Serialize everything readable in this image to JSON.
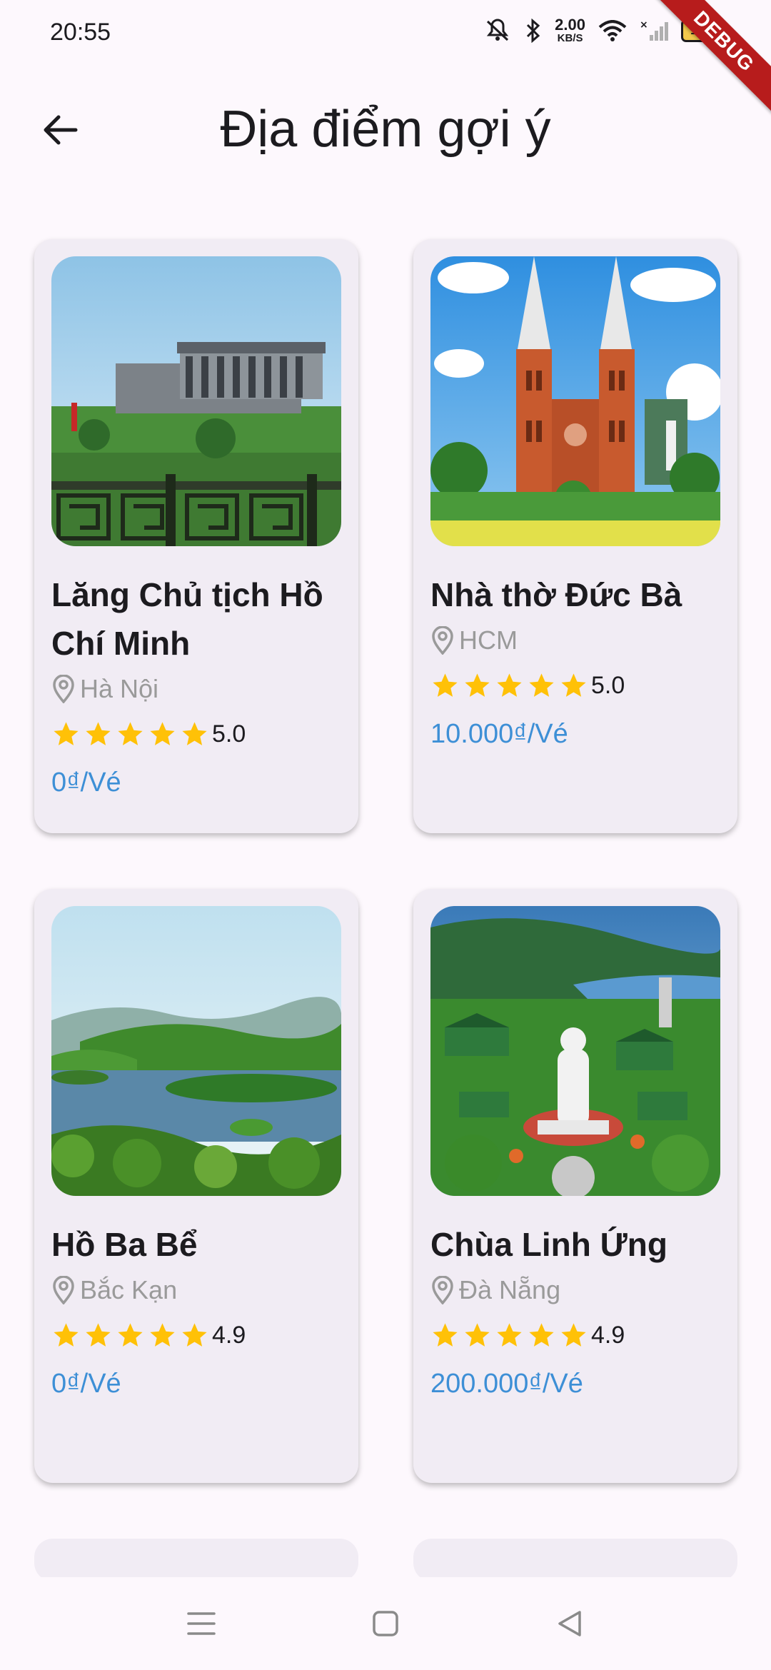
{
  "status": {
    "time": "20:55",
    "net_speed_value": "2.00",
    "net_speed_unit": "KB/S",
    "battery": "100",
    "debug_label": "DEBUG"
  },
  "header": {
    "title": "Địa điểm gợi ý"
  },
  "places": [
    {
      "name": "Lăng Chủ tịch Hồ Chí Minh",
      "location": "Hà Nội",
      "rating": "5.0",
      "price": "0₫/Vé",
      "image": "mausoleum"
    },
    {
      "name": "Nhà thờ Đức Bà",
      "location": "HCM",
      "rating": "5.0",
      "price": "10.000₫/Vé",
      "image": "cathedral"
    },
    {
      "name": "Hồ Ba Bể",
      "location": "Bắc Kạn",
      "rating": "4.9",
      "price": "0₫/Vé",
      "image": "lake"
    },
    {
      "name": "Chùa Linh Ứng",
      "location": "Đà Nẵng",
      "rating": "4.9",
      "price": "200.000₫/Vé",
      "image": "pagoda"
    }
  ],
  "colors": {
    "accent_price": "#3d8fd6",
    "star": "#ffc107",
    "card_bg": "#f1ecf4",
    "page_bg": "#fdf8fd"
  },
  "icons": [
    "back-arrow-icon",
    "location-pin-icon",
    "star-icon",
    "menu-icon",
    "home-square-icon",
    "back-triangle-icon"
  ]
}
